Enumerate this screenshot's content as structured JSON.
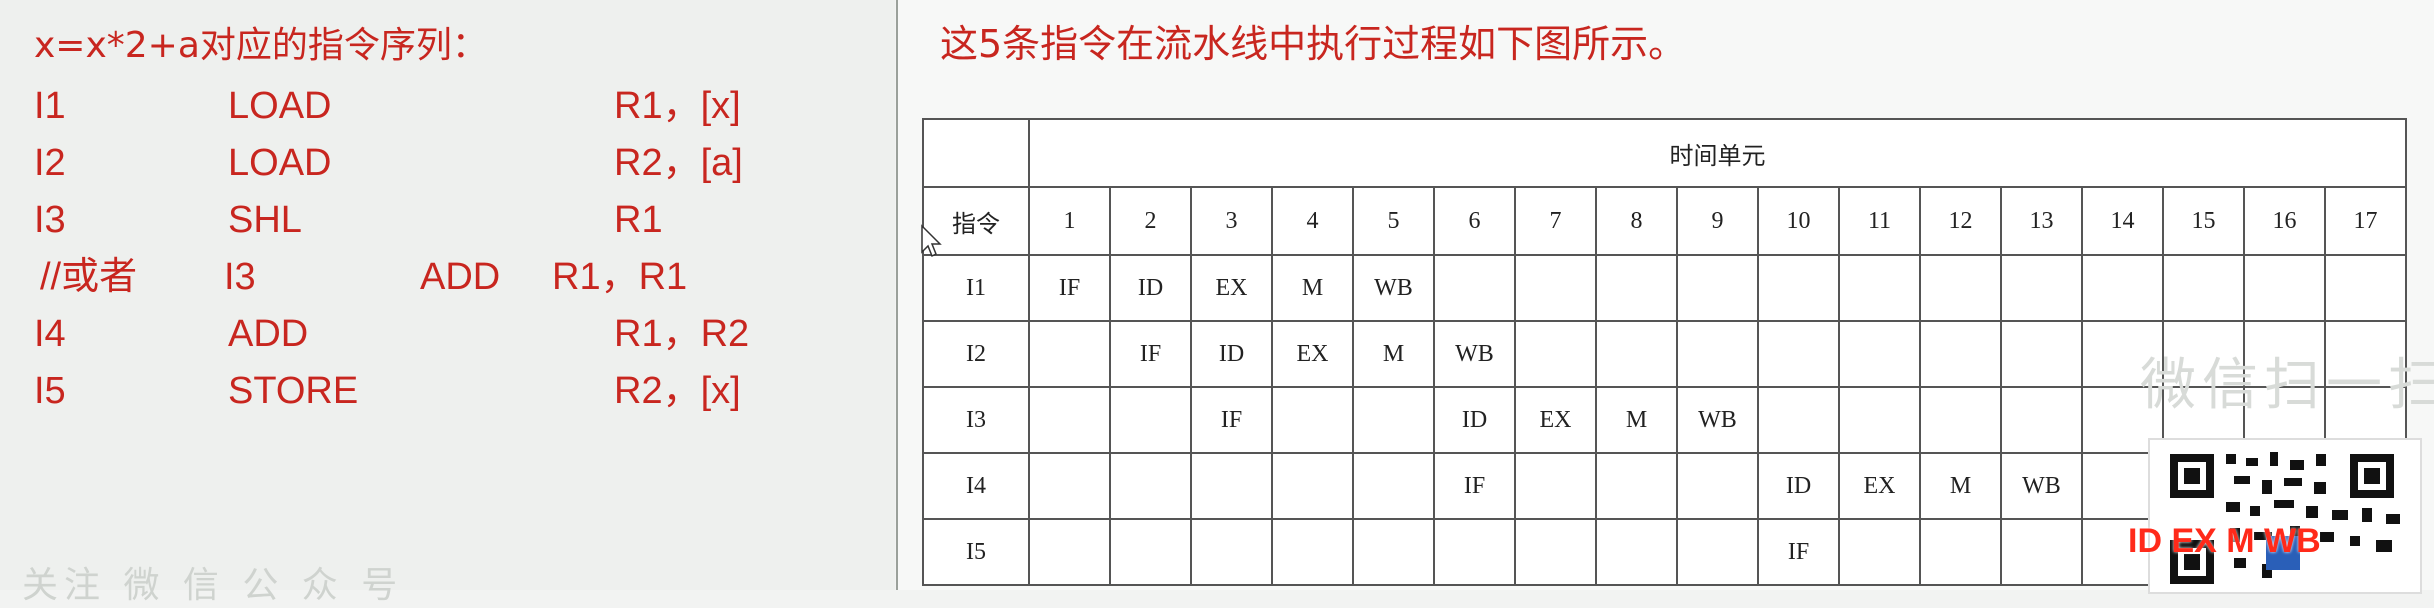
{
  "left": {
    "title": "x=x*2+a对应的指令序列：",
    "instructions": [
      {
        "name": "I1",
        "op": "LOAD",
        "args": "R1，[x]"
      },
      {
        "name": "I2",
        "op": "LOAD",
        "args": "R2，[a]"
      },
      {
        "name": "I3",
        "op": "SHL",
        "args": "R1"
      }
    ],
    "alt": {
      "prefix": "//或者",
      "name": "I3",
      "op": "ADD",
      "args": "R1，R1"
    },
    "instructions2": [
      {
        "name": "I4",
        "op": "ADD",
        "args": "R1，R2"
      },
      {
        "name": "I5",
        "op": "STORE",
        "args": "R2，[x]"
      }
    ],
    "faded_text": "关注 微 信 公 众 号"
  },
  "right": {
    "title": "这5条指令在流水线中执行过程如下图所示。",
    "table": {
      "group_header": "时间单元",
      "instr_header": "指令",
      "time_units": [
        "1",
        "2",
        "3",
        "4",
        "5",
        "6",
        "7",
        "8",
        "9",
        "10",
        "11",
        "12",
        "13",
        "14",
        "15",
        "16",
        "17"
      ],
      "rows": [
        {
          "label": "I1",
          "cells": [
            "IF",
            "ID",
            "EX",
            "M",
            "WB",
            "",
            "",
            "",
            "",
            "",
            "",
            "",
            "",
            "",
            "",
            "",
            ""
          ]
        },
        {
          "label": "I2",
          "cells": [
            "",
            "IF",
            "ID",
            "EX",
            "M",
            "WB",
            "",
            "",
            "",
            "",
            "",
            "",
            "",
            "",
            "",
            "",
            ""
          ]
        },
        {
          "label": "I3",
          "cells": [
            "",
            "",
            "IF",
            "",
            "",
            "ID",
            "EX",
            "M",
            "WB",
            "",
            "",
            "",
            "",
            "",
            "",
            "",
            ""
          ]
        },
        {
          "label": "I4",
          "cells": [
            "",
            "",
            "",
            "",
            "",
            "IF",
            "",
            "",
            "",
            "ID",
            "EX",
            "M",
            "WB",
            "",
            "",
            "",
            ""
          ]
        },
        {
          "label": "I5",
          "cells": [
            "",
            "",
            "",
            "",
            "",
            "",
            "",
            "",
            "",
            "IF",
            "",
            "",
            "",
            "",
            "",
            "",
            ""
          ]
        }
      ]
    },
    "watermark": "微信扫一扫",
    "qr_overlay": "ID EX M WB"
  },
  "colors": {
    "accent_red": "#c8261f",
    "overlay_red": "#ff2a1a",
    "table_border": "#555555"
  }
}
